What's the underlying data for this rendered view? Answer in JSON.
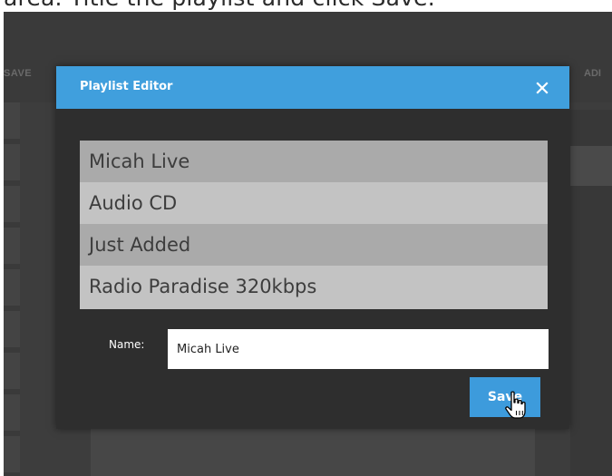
{
  "caption": "area. Title the playlist and click Save.",
  "background": {
    "toolbar_left": "SAVE",
    "toolbar_right": "ADI"
  },
  "dialog": {
    "title": "Playlist Editor",
    "close_icon": "close-x-icon",
    "header_color": "#409fdd",
    "playlists": [
      "Micah Live",
      "Audio CD",
      "Just Added",
      "Radio Paradise 320kbps"
    ],
    "name_label": "Name:",
    "name_value": "Micah Live",
    "save_label": "Save",
    "save_color": "#3d9bdc"
  },
  "cursor_icon": "hand-pointer-icon"
}
